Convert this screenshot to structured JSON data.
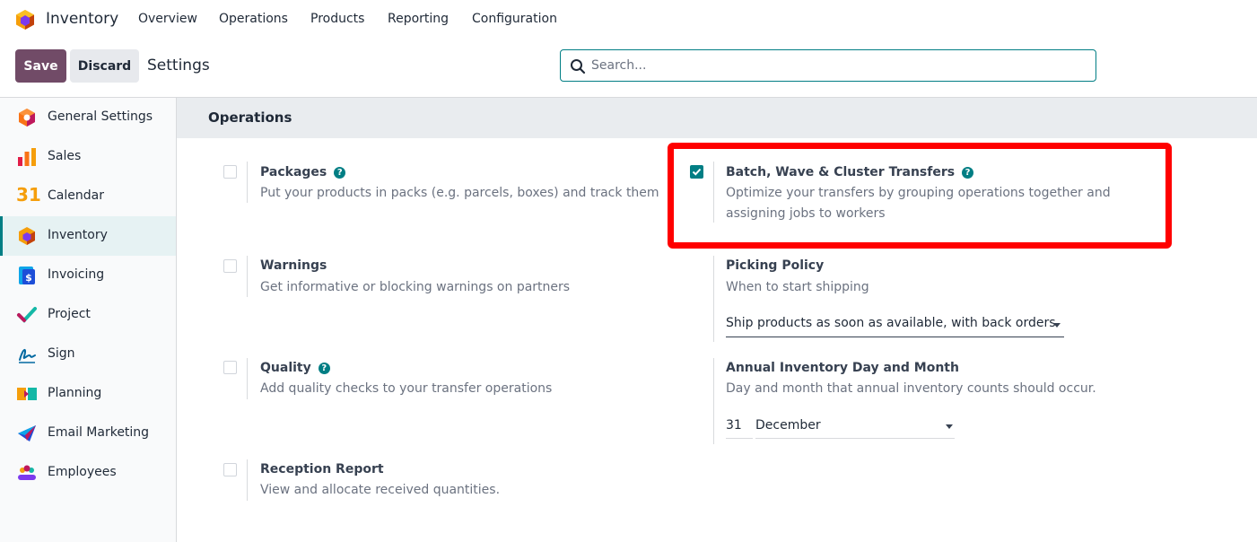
{
  "app": {
    "name": "Inventory"
  },
  "nav": {
    "items": [
      "Overview",
      "Operations",
      "Products",
      "Reporting",
      "Configuration"
    ]
  },
  "toolbar": {
    "save_label": "Save",
    "discard_label": "Discard",
    "title": "Settings"
  },
  "search": {
    "placeholder": "Search..."
  },
  "sidebar": {
    "items": [
      {
        "label": "General Settings",
        "icon": "general-settings-icon"
      },
      {
        "label": "Sales",
        "icon": "sales-icon"
      },
      {
        "label": "Calendar",
        "icon": "calendar-icon"
      },
      {
        "label": "Inventory",
        "icon": "inventory-icon",
        "active": true
      },
      {
        "label": "Invoicing",
        "icon": "invoicing-icon"
      },
      {
        "label": "Project",
        "icon": "project-icon"
      },
      {
        "label": "Sign",
        "icon": "sign-icon"
      },
      {
        "label": "Planning",
        "icon": "planning-icon"
      },
      {
        "label": "Email Marketing",
        "icon": "email-marketing-icon"
      },
      {
        "label": "Employees",
        "icon": "employees-icon"
      }
    ],
    "calendar_icon_text": "31"
  },
  "section": {
    "title": "Operations"
  },
  "settings": {
    "packages": {
      "title": "Packages",
      "desc": "Put your products in packs (e.g. parcels, boxes) and track them",
      "checked": false
    },
    "batch": {
      "title": "Batch, Wave & Cluster Transfers",
      "desc": "Optimize your transfers by grouping operations together and assigning jobs to workers",
      "checked": true
    },
    "warnings": {
      "title": "Warnings",
      "desc": "Get informative or blocking warnings on partners",
      "checked": false
    },
    "picking": {
      "title": "Picking Policy",
      "desc": "When to start shipping",
      "value": "Ship products as soon as available, with back orders"
    },
    "quality": {
      "title": "Quality",
      "desc": "Add quality checks to your transfer operations",
      "checked": false
    },
    "annual": {
      "title": "Annual Inventory Day and Month",
      "desc": "Day and month that annual inventory counts should occur.",
      "day": "31",
      "month": "December"
    },
    "reception": {
      "title": "Reception Report",
      "desc": "View and allocate received quantities.",
      "checked": false
    }
  },
  "colors": {
    "brand": "#714b67",
    "accent": "#017e84",
    "highlight": "#ff0000"
  }
}
